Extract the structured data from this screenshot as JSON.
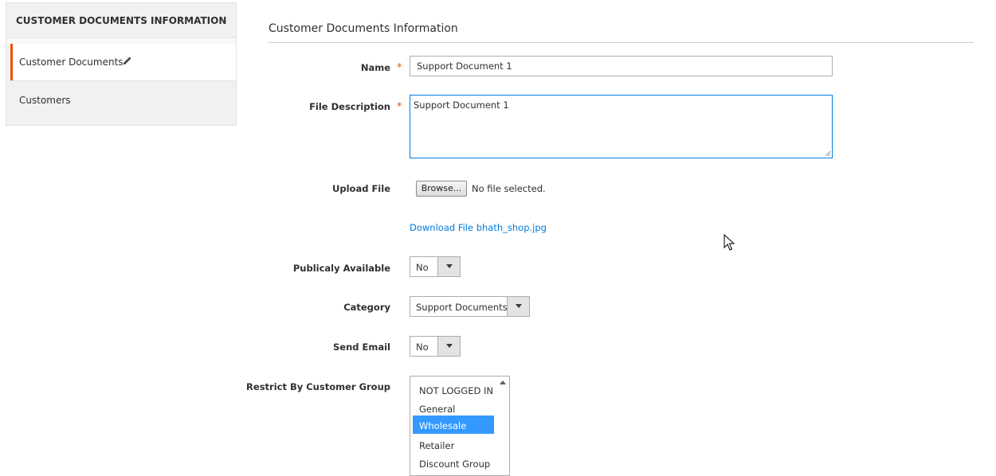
{
  "sidebar": {
    "title": "CUSTOMER DOCUMENTS INFORMATION",
    "items": [
      {
        "label": "Customer Documents",
        "active": true,
        "icon": "pencil-icon"
      },
      {
        "label": "Customers",
        "active": false
      }
    ]
  },
  "main": {
    "title": "Customer Documents Information"
  },
  "form": {
    "name": {
      "label": "Name",
      "required_mark": "*",
      "value": "Support Document 1"
    },
    "file_description": {
      "label": "File Description",
      "required_mark": "*",
      "value": "Support Document 1"
    },
    "upload_file": {
      "label": "Upload File",
      "browse_label": "Browse...",
      "status": "No file selected."
    },
    "download_link": "Download File bhath_shop.jpg",
    "publicly_available": {
      "label": "Publicaly Available",
      "value": "No"
    },
    "category": {
      "label": "Category",
      "value": "Support Documents"
    },
    "send_email": {
      "label": "Send Email",
      "value": "No"
    },
    "restrict_by_group": {
      "label": "Restrict By Customer Group",
      "options": [
        "NOT LOGGED IN",
        "General",
        "Wholesale",
        "Retailer",
        "Discount Group"
      ],
      "selected": "Wholesale"
    }
  },
  "colors": {
    "accent": "#eb5202",
    "link": "#007bdb",
    "selection": "#3399ff"
  }
}
